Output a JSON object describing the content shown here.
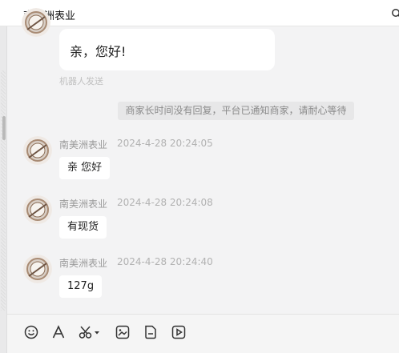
{
  "header": {
    "title": "南美洲表业",
    "search_icon": "search-icon"
  },
  "chat": {
    "greeting": {
      "text": "亲，您好!",
      "bot_note": "机器人发送"
    },
    "system_notice": "商家长时间没有回复，平台已通知商家，请耐心等待",
    "messages": [
      {
        "sender": "南美洲表业",
        "time": "2024-4-28 20:24:05",
        "text": "亲 您好"
      },
      {
        "sender": "南美洲表业",
        "time": "2024-4-28 20:24:08",
        "text": "有现货"
      },
      {
        "sender": "南美洲表业",
        "time": "2024-4-28 20:24:40",
        "text": "127g"
      }
    ]
  },
  "toolbar": {
    "icons": [
      "emoji-icon",
      "font-icon",
      "scissors-icon",
      "image-icon",
      "file-icon",
      "video-icon"
    ]
  },
  "colors": {
    "background": "#f3f3f4",
    "bubble": "#ffffff",
    "notice_bg": "#e7e7e8",
    "muted_text": "#999999"
  }
}
